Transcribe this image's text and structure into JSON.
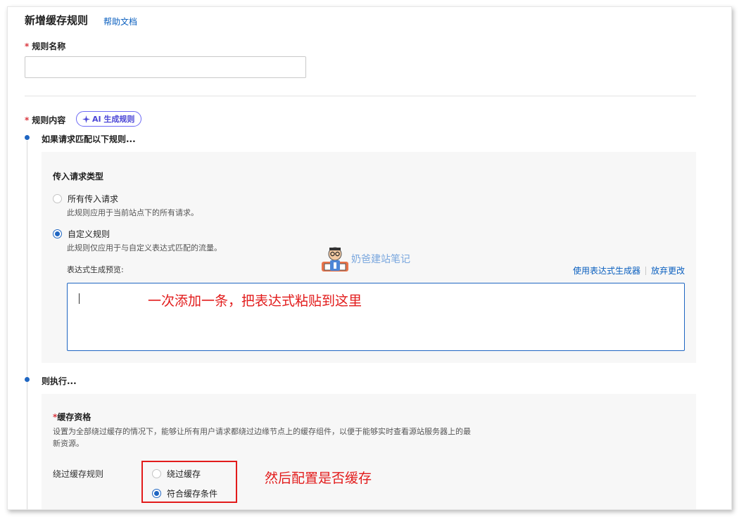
{
  "header": {
    "title": "新增缓存规则",
    "help_link": "帮助文档"
  },
  "rule_name": {
    "required_mark": "*",
    "label": "规则名称",
    "value": ""
  },
  "rule_content": {
    "required_mark": "*",
    "label": "规则内容",
    "ai_button": "AI 生成规则",
    "ai_icon": "sparkle-icon"
  },
  "condition_step": {
    "label": "如果请求匹配以下规则...",
    "panel_title": "传入请求类型",
    "options": [
      {
        "label": "所有传入请求",
        "description": "此规则应用于当前站点下的所有请求。",
        "checked": false
      },
      {
        "label": "自定义规则",
        "description": "此规则仅应用于与自定义表达式匹配的流量。",
        "checked": true
      }
    ],
    "expression_preview_label": "表达式生成预览:",
    "use_builder_link": "使用表达式生成器",
    "discard_link": "放弃更改",
    "expression_value": ""
  },
  "action_step": {
    "label": "则执行...",
    "required_mark": "*",
    "cache_title": "缓存资格",
    "cache_description_line1": "设置为全部绕过缓存的情况下，能够让所有用户请求都绕过边缘节点上的缓存组件，以便于能够实时查看源站服务器上的最",
    "cache_description_line2": "新资源。",
    "bypass_label": "绕过缓存规则",
    "options": [
      {
        "label": "绕过缓存",
        "checked": false
      },
      {
        "label": "符合缓存条件",
        "checked": true
      }
    ]
  },
  "annotations": {
    "expression_hint": "一次添加一条，把表达式粘贴到这里",
    "cache_hint": "然后配置是否缓存"
  },
  "watermark": {
    "text": "奶爸建站笔记",
    "icon": "mascot-icon"
  },
  "colors": {
    "primary": "#1f66c2",
    "link": "#0a5fbf",
    "annotation_red": "#e21b1b",
    "ai_accent": "#4a45d6",
    "required": "#d9363e"
  }
}
